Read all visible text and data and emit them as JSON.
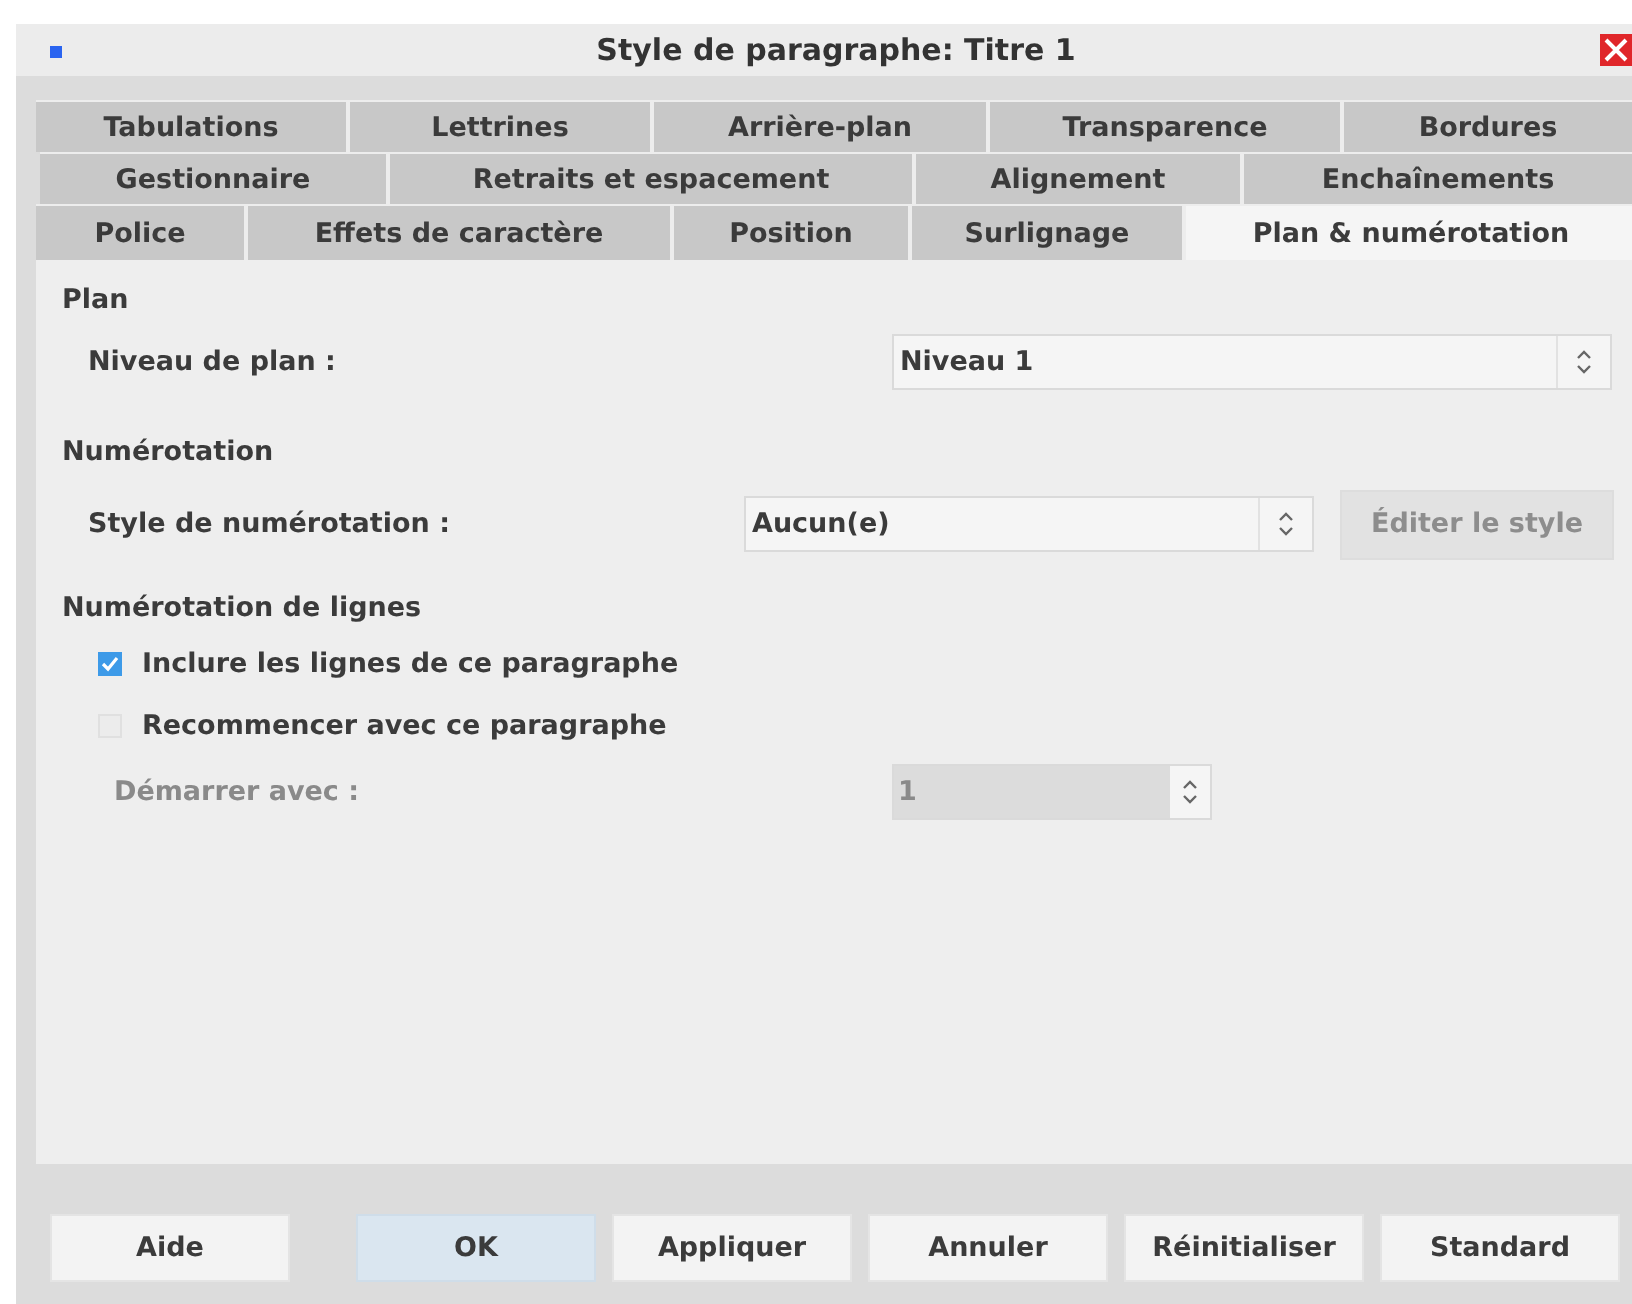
{
  "window": {
    "title": "Style de paragraphe: Titre 1"
  },
  "tab_rows": [
    [
      {
        "label": "Tabulations",
        "selected": false
      },
      {
        "label": "Lettrines",
        "selected": false
      },
      {
        "label": "Arrière-plan",
        "selected": false
      },
      {
        "label": "Transparence",
        "selected": false
      },
      {
        "label": "Bordures",
        "selected": false
      }
    ],
    [
      {
        "label": "Gestionnaire",
        "selected": false
      },
      {
        "label": "Retraits et espacement",
        "selected": false
      },
      {
        "label": "Alignement",
        "selected": false
      },
      {
        "label": "Enchaînements",
        "selected": false
      }
    ],
    [
      {
        "label": "Police",
        "selected": false
      },
      {
        "label": "Effets de caractère",
        "selected": false
      },
      {
        "label": "Position",
        "selected": false
      },
      {
        "label": "Surlignage",
        "selected": false
      },
      {
        "label": "Plan & numérotation",
        "selected": true
      }
    ]
  ],
  "plan": {
    "heading": "Plan",
    "label": "Niveau de plan :",
    "value": "Niveau 1"
  },
  "numbering": {
    "heading": "Numérotation",
    "label": "Style de numérotation :",
    "value": "Aucun(e)",
    "edit_button": {
      "label": "Éditer le style",
      "disabled": true
    }
  },
  "line_numbering": {
    "heading": "Numérotation de lignes",
    "checkboxes": [
      {
        "label": "Inclure les lignes de ce paragraphe",
        "checked": true,
        "disabled": false
      },
      {
        "label": "Recommencer avec ce paragraphe",
        "checked": false,
        "disabled": true
      }
    ],
    "start": {
      "label": "Démarrer avec :",
      "value": "1",
      "disabled": true
    }
  },
  "buttons": [
    {
      "label": "Aide",
      "default": false
    },
    {
      "label": "OK",
      "default": true
    },
    {
      "label": "Appliquer",
      "default": false
    },
    {
      "label": "Annuler",
      "default": false
    },
    {
      "label": "Réinitialiser",
      "default": false
    },
    {
      "label": "Standard",
      "default": false
    }
  ]
}
